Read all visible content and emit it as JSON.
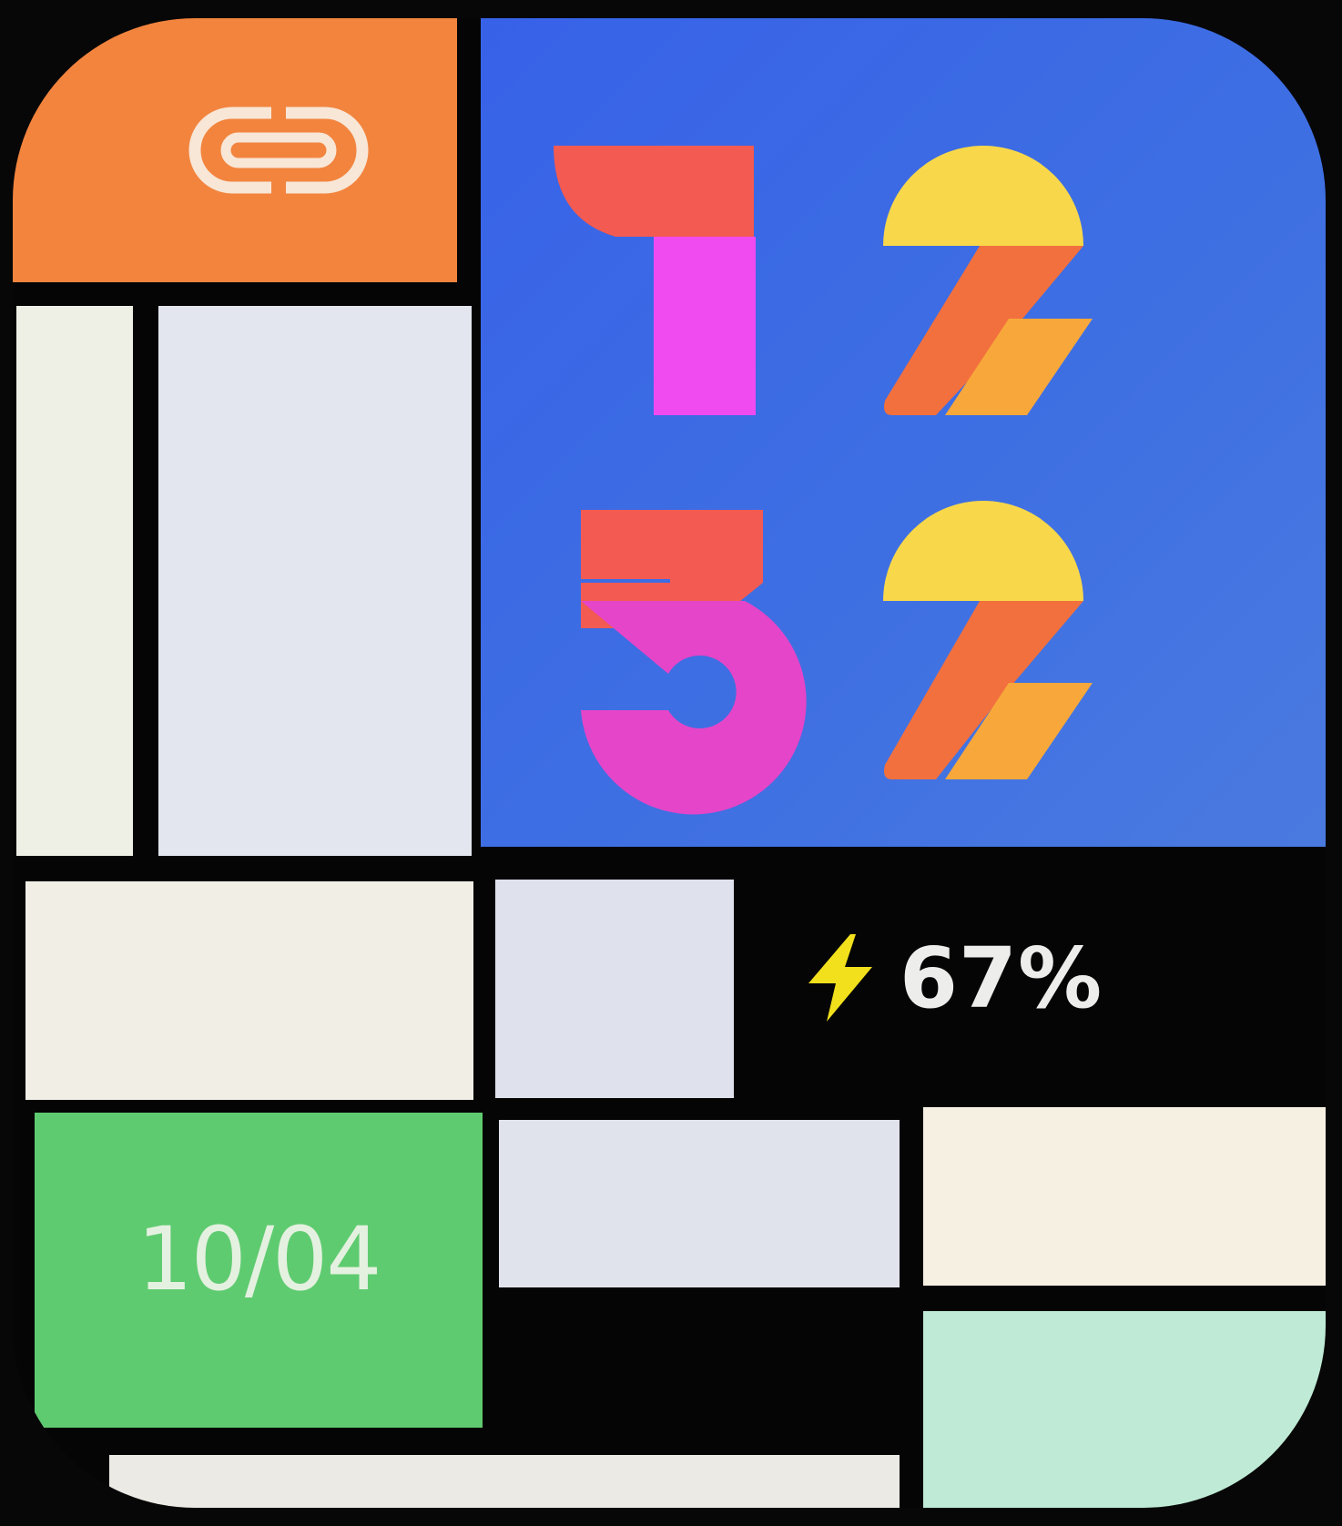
{
  "watch_face": {
    "time": {
      "hour_tens": "1",
      "hour_ones": "2",
      "minute_tens": "3",
      "minute_ones": "2"
    },
    "battery": {
      "percent_label": "67%",
      "icon": "lightning-bolt-icon"
    },
    "date": {
      "label": "10/04"
    },
    "shortcut": {
      "icon": "link-icon"
    },
    "colors": {
      "background": "#070707",
      "orange_tile": "#F2843E",
      "blue_tile": "#3A6CE6",
      "green_tile": "#5FCB70",
      "mint_tile": "#BFEBD6",
      "cream_tile": "#F6F0E3",
      "grey_tile": "#E1E3EC",
      "digit_red": "#F25A52",
      "digit_magenta": "#F04BF0",
      "digit_yellow": "#F8D84A",
      "digit_orange": "#F2703E",
      "digit_amber": "#F8A83A",
      "bolt_yellow": "#F2E01C"
    }
  }
}
